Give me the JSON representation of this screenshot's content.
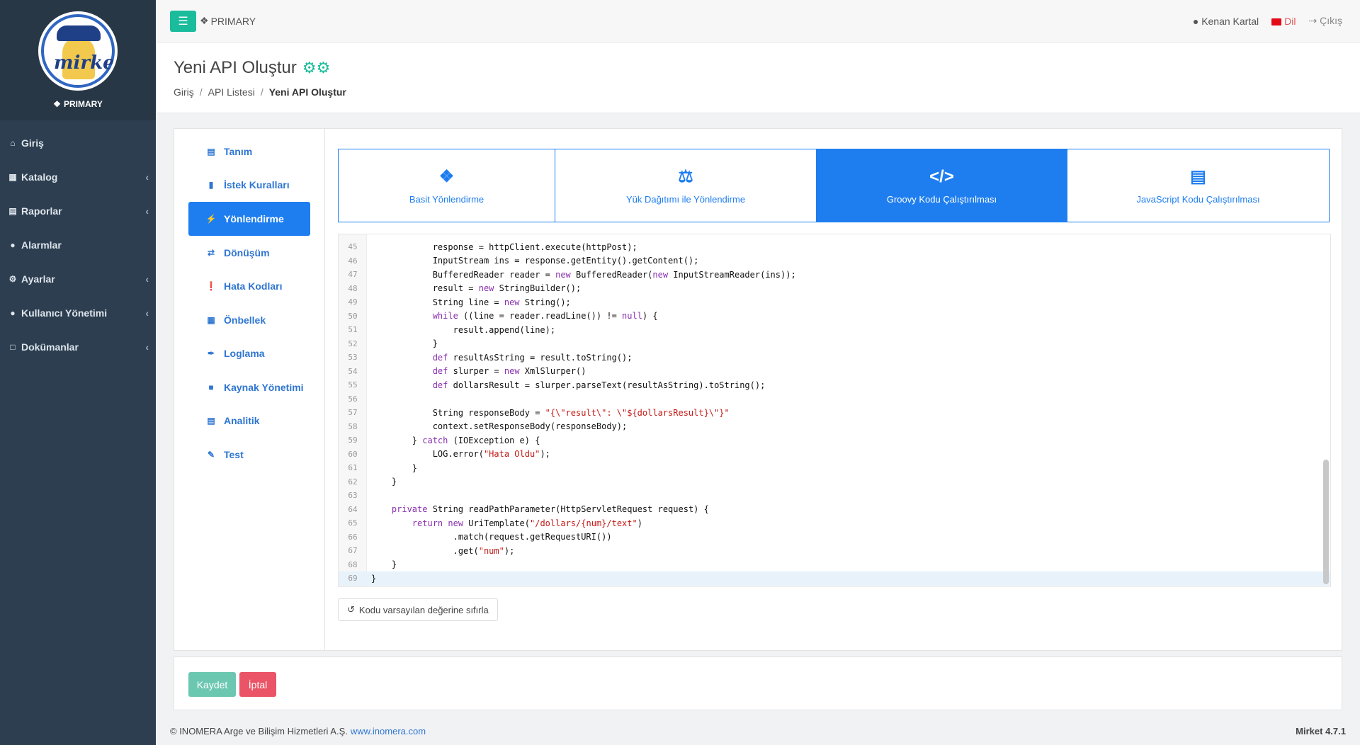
{
  "sidebar": {
    "brand_text": "mirket",
    "role": "PRIMARY",
    "items": [
      {
        "label": "Giriş",
        "icon": "home-icon",
        "has_chevron": false
      },
      {
        "label": "Katalog",
        "icon": "sitemap-icon",
        "has_chevron": true
      },
      {
        "label": "Raporlar",
        "icon": "chart-icon",
        "has_chevron": true
      },
      {
        "label": "Alarmlar",
        "icon": "bell-icon",
        "has_chevron": false
      },
      {
        "label": "Ayarlar",
        "icon": "gears-icon",
        "has_chevron": true
      },
      {
        "label": "Kullanıcı Yönetimi",
        "icon": "users-icon",
        "has_chevron": true
      },
      {
        "label": "Dokümanlar",
        "icon": "file-icon",
        "has_chevron": true
      }
    ]
  },
  "topbar": {
    "role": "PRIMARY",
    "user": "Kenan Kartal",
    "language": "Dil",
    "logout": "Çıkış"
  },
  "header": {
    "title": "Yeni API Oluştur",
    "breadcrumb": [
      "Giriş",
      "API Listesi",
      "Yeni API Oluştur"
    ]
  },
  "left_menu": {
    "items": [
      {
        "label": "Tanım",
        "icon": "id-card-icon"
      },
      {
        "label": "İstek Kuralları",
        "icon": "book-icon"
      },
      {
        "label": "Yönlendirme",
        "icon": "bolt-icon",
        "active": true
      },
      {
        "label": "Dönüşüm",
        "icon": "exchange-icon"
      },
      {
        "label": "Hata Kodları",
        "icon": "exclamation-icon"
      },
      {
        "label": "Önbellek",
        "icon": "memory-icon"
      },
      {
        "label": "Loglama",
        "icon": "feather-icon"
      },
      {
        "label": "Kaynak Yönetimi",
        "icon": "lock-icon"
      },
      {
        "label": "Analitik",
        "icon": "area-chart-icon"
      },
      {
        "label": "Test",
        "icon": "pencil-icon"
      }
    ]
  },
  "tabs": [
    {
      "label": "Basit Yönlendirme",
      "icon": "puzzle-icon"
    },
    {
      "label": "Yük Dağıtımı ile Yönlendirme",
      "icon": "balance-scale-icon"
    },
    {
      "label": "Groovy Kodu Çalıştırılması",
      "icon": "code-icon",
      "active": true
    },
    {
      "label": "JavaScript Kodu Çalıştırılması",
      "icon": "laptop-code-icon"
    }
  ],
  "editor": {
    "lines": [
      {
        "n": "45",
        "t": "            response = httpClient.execute(httpPost);"
      },
      {
        "n": "46",
        "t": "            InputStream ins = response.getEntity().getContent();"
      },
      {
        "n": "47",
        "t": "            BufferedReader reader = new BufferedReader(new InputStreamReader(ins));"
      },
      {
        "n": "48",
        "t": "            result = new StringBuilder();"
      },
      {
        "n": "49",
        "t": "            String line = new String();"
      },
      {
        "n": "50",
        "t": "            while ((line = reader.readLine()) != null) {"
      },
      {
        "n": "51",
        "t": "                result.append(line);"
      },
      {
        "n": "52",
        "t": "            }"
      },
      {
        "n": "53",
        "t": "            def resultAsString = result.toString();"
      },
      {
        "n": "54",
        "t": "            def slurper = new XmlSlurper()"
      },
      {
        "n": "55",
        "t": "            def dollarsResult = slurper.parseText(resultAsString).toString();"
      },
      {
        "n": "56",
        "t": ""
      },
      {
        "n": "57",
        "t": "            String responseBody = \"{\\\"result\\\": \\\"${dollarsResult}\\\"}\""
      },
      {
        "n": "58",
        "t": "            context.setResponseBody(responseBody);"
      },
      {
        "n": "59",
        "t": "        } catch (IOException e) {"
      },
      {
        "n": "60",
        "t": "            LOG.error(\"Hata Oldu\");"
      },
      {
        "n": "61",
        "t": "        }"
      },
      {
        "n": "62",
        "t": "    }"
      },
      {
        "n": "63",
        "t": ""
      },
      {
        "n": "64",
        "t": "    private String readPathParameter(HttpServletRequest request) {"
      },
      {
        "n": "65",
        "t": "        return new UriTemplate(\"/dollars/{num}/text\")"
      },
      {
        "n": "66",
        "t": "                .match(request.getRequestURI())"
      },
      {
        "n": "67",
        "t": "                .get(\"num\");"
      },
      {
        "n": "68",
        "t": "    }"
      },
      {
        "n": "69",
        "t": "}"
      }
    ],
    "current_line": "69"
  },
  "reset_button": "Kodu varsayılan değerine sıfırla",
  "actions": {
    "save": "Kaydet",
    "cancel": "İptal"
  },
  "footer": {
    "copyright": "© INOMERA Arge ve Bilişim Hizmetleri A.Ş.",
    "link": "www.inomera.com",
    "version": "Mirket 4.7.1"
  },
  "colors": {
    "sidebar": "#2c3e50",
    "accent": "#1e7ef0",
    "teal": "#1abc9c",
    "danger": "#ea5466"
  }
}
